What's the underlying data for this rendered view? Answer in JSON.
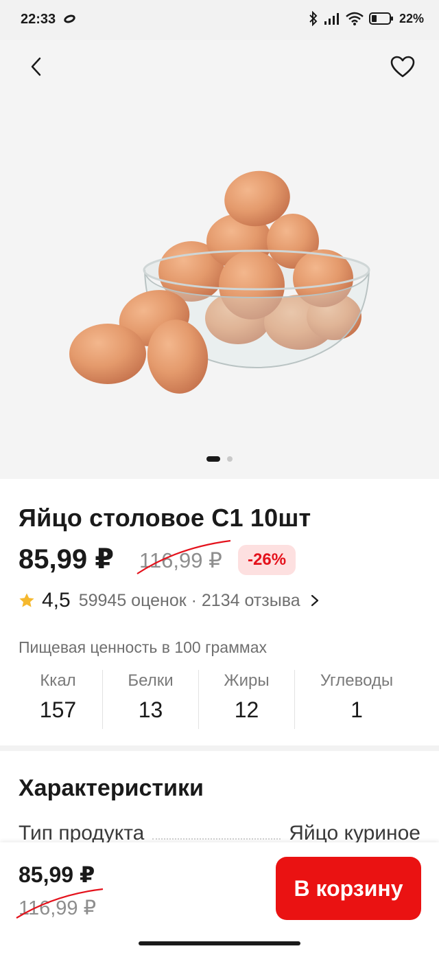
{
  "status_bar": {
    "time": "22:33",
    "battery": "22%"
  },
  "product": {
    "title": "Яйцо столовое С1 10шт",
    "price": "85,99 ₽",
    "old_price": "116,99 ₽",
    "discount": "-26%",
    "image_icon": "eggs-in-bowl-image",
    "gallery_pages": 2,
    "gallery_active": 1
  },
  "rating": {
    "value": "4,5",
    "meta": "59945 оценок · 2134 отзыва"
  },
  "nutrition": {
    "title": "Пищевая ценность в 100 граммах",
    "items": [
      {
        "label": "Ккал",
        "value": "157"
      },
      {
        "label": "Белки",
        "value": "13"
      },
      {
        "label": "Жиры",
        "value": "12"
      },
      {
        "label": "Углеводы",
        "value": "1"
      }
    ]
  },
  "characteristics": {
    "title": "Характеристики",
    "rows": [
      {
        "name": "Тип продукта",
        "value": "Яйцо куриное"
      }
    ]
  },
  "bottom_bar": {
    "price": "85,99 ₽",
    "old_price": "116,99 ₽",
    "cart_label": "В корзину"
  },
  "colors": {
    "accent": "#ea1212",
    "discount_bg": "#fde0e0",
    "discount_text": "#e4121c",
    "star": "#f5b82e"
  }
}
